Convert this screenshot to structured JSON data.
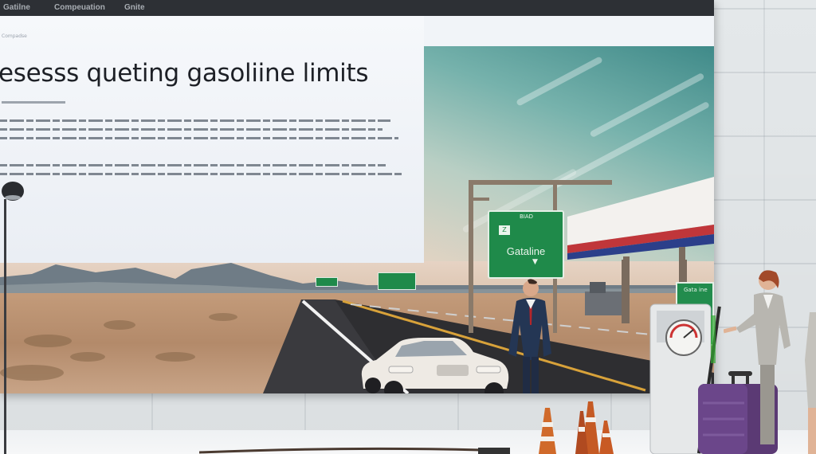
{
  "screen": {
    "nav": [
      "Gatilne",
      "Compeuation",
      "Gnite"
    ],
    "breadcrumb": "Compadse",
    "headline": "esesss queting gasoliine limits"
  },
  "signs": {
    "main_small": "BIAD",
    "main_shield": "Z",
    "main_big": "Gataline",
    "main_arrow": "▼",
    "side_text": "Gata ine"
  },
  "colors": {
    "topbar": "#2d3035",
    "sign_green": "#1f8a4a",
    "sky_teal": "#3f8a89"
  }
}
